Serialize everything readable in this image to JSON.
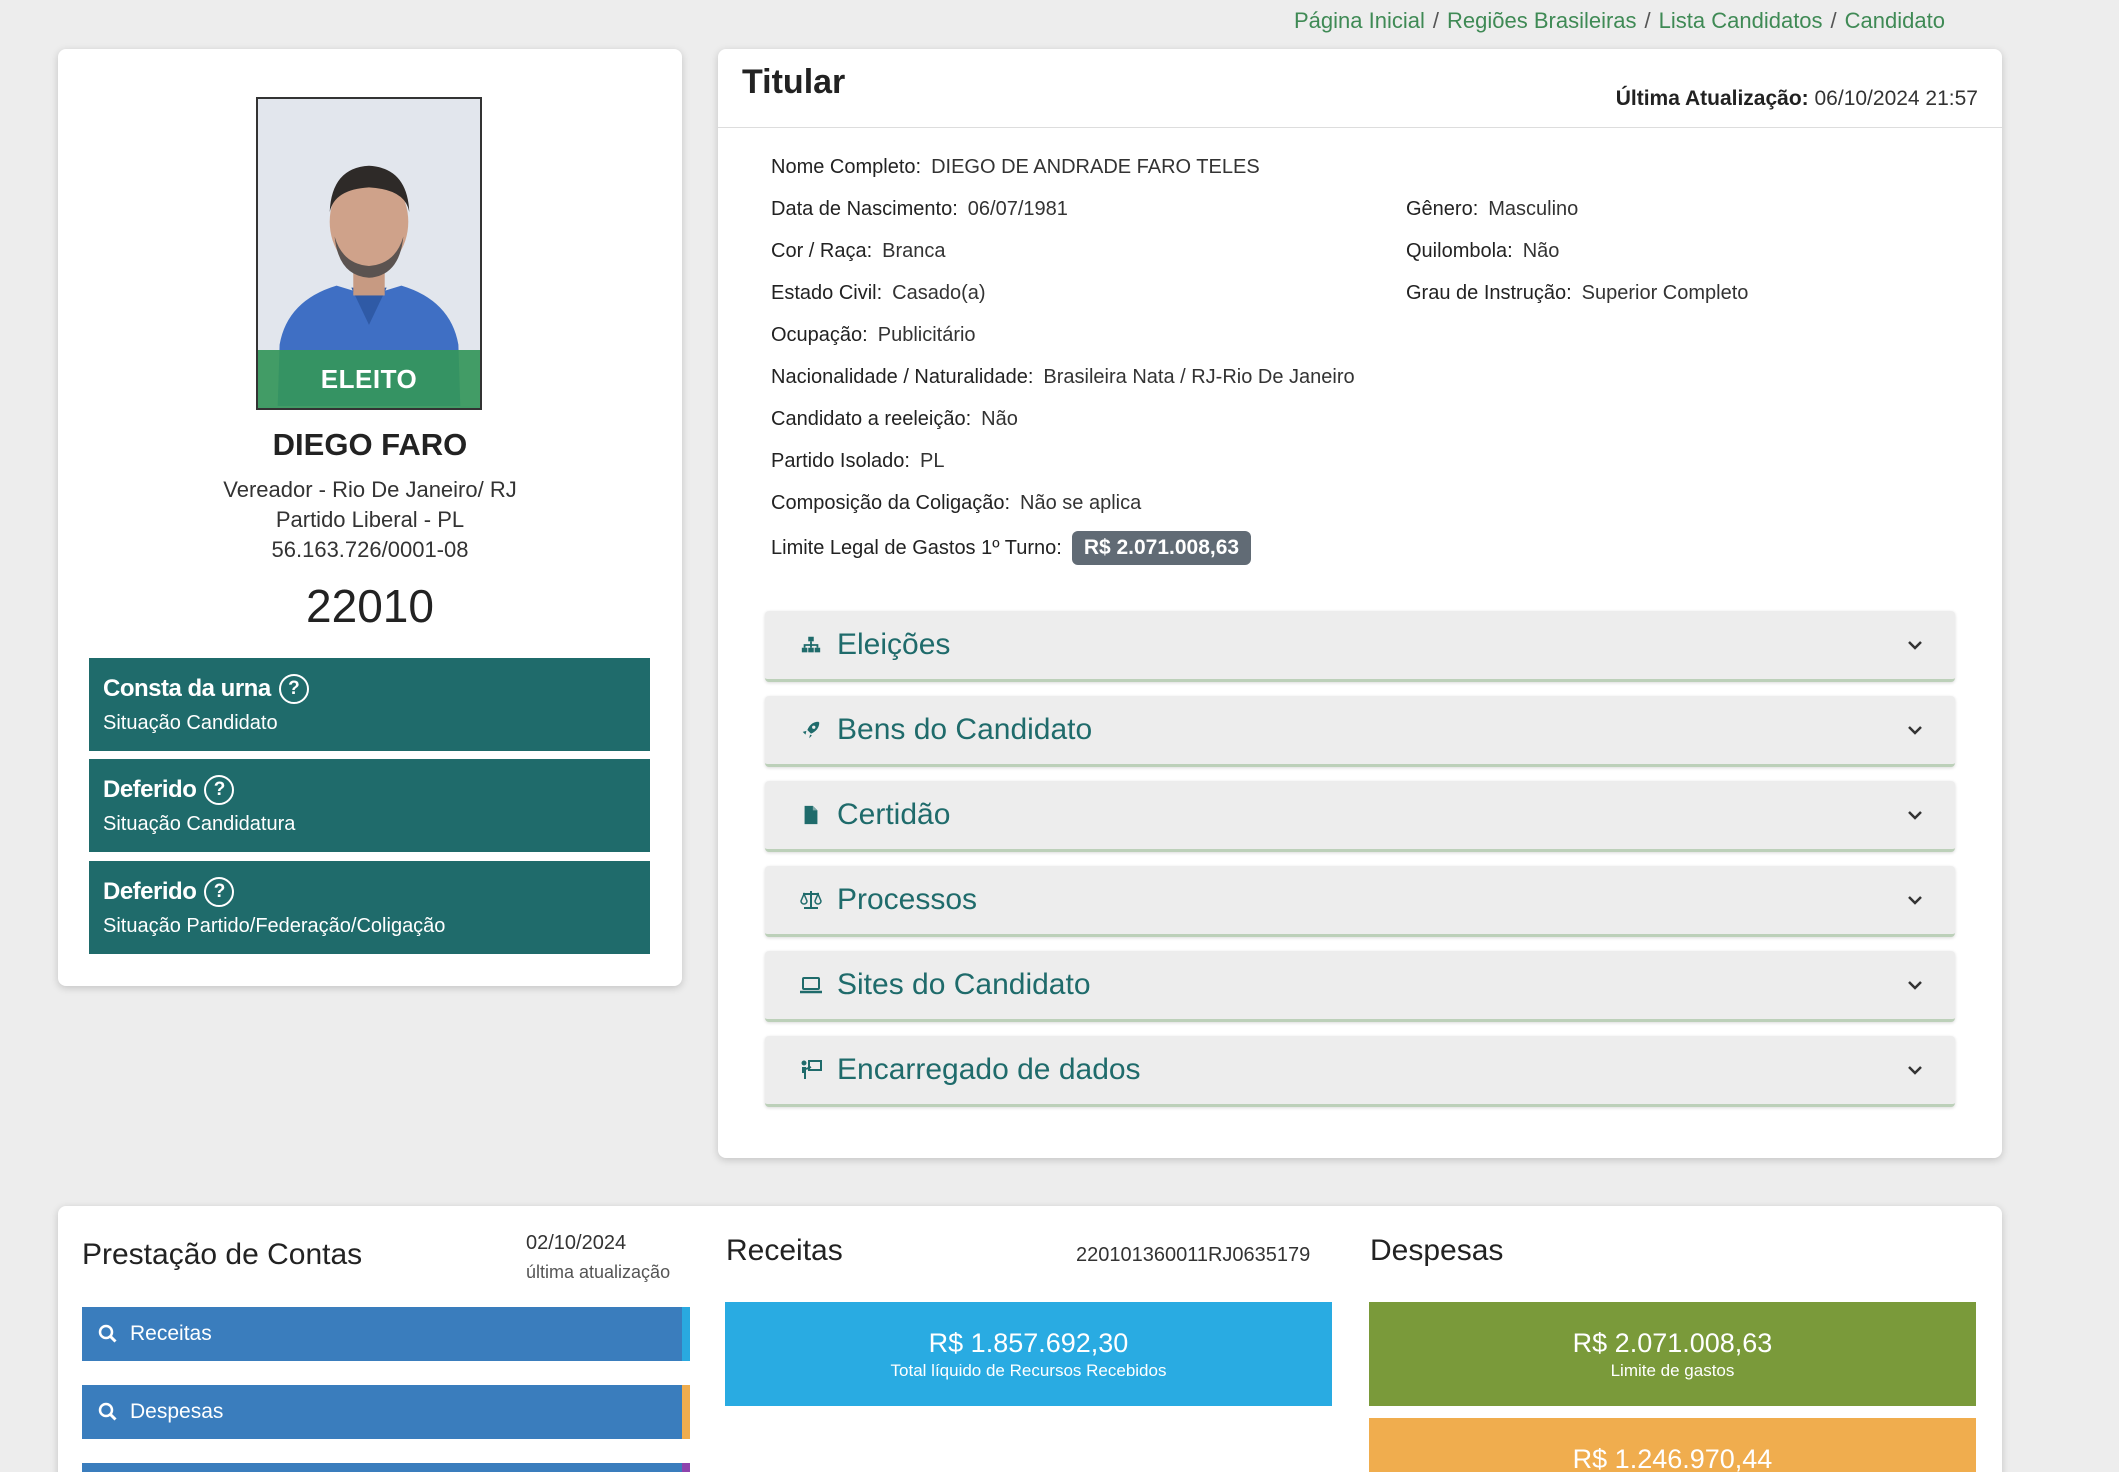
{
  "breadcrumb": {
    "items": [
      "Página Inicial",
      "Regiões Brasileiras",
      "Lista Candidatos",
      "Candidato"
    ],
    "separator": "/"
  },
  "candidate": {
    "photo_status": "ELEITO",
    "name": "DIEGO FARO",
    "office_line": "Vereador - Rio De Janeiro/ RJ",
    "party_line": "Partido Liberal - PL",
    "cnpj": "56.163.726/0001-08",
    "number": "22010",
    "statuses": [
      {
        "title": "Consta da urna",
        "subtitle": "Situação Candidato"
      },
      {
        "title": "Deferido",
        "subtitle": "Situação Candidatura"
      },
      {
        "title": "Deferido",
        "subtitle": "Situação Partido/Federação/Coligação"
      }
    ]
  },
  "titular": {
    "title": "Titular",
    "update_label": "Última Atualização:",
    "update_value": "06/10/2024 21:57",
    "fields": {
      "nome_completo": {
        "label": "Nome Completo:",
        "value": "DIEGO DE ANDRADE FARO TELES"
      },
      "data_nascimento": {
        "label": "Data de Nascimento:",
        "value": "06/07/1981"
      },
      "genero": {
        "label": "Gênero:",
        "value": "Masculino"
      },
      "cor_raca": {
        "label": "Cor / Raça:",
        "value": "Branca"
      },
      "quilombola": {
        "label": "Quilombola:",
        "value": "Não"
      },
      "estado_civil": {
        "label": "Estado Civil:",
        "value": "Casado(a)"
      },
      "grau_instrucao": {
        "label": "Grau de Instrução:",
        "value": "Superior Completo"
      },
      "ocupacao": {
        "label": "Ocupação:",
        "value": "Publicitário"
      },
      "nacionalidade": {
        "label": "Nacionalidade / Naturalidade:",
        "value": "Brasileira Nata / RJ-Rio De Janeiro"
      },
      "reeleicao": {
        "label": "Candidato a reeleição:",
        "value": "Não"
      },
      "partido": {
        "label": "Partido Isolado:",
        "value": "PL"
      },
      "coligacao": {
        "label": "Composição da Coligação:",
        "value": "Não se aplica"
      },
      "limite": {
        "label": "Limite Legal de Gastos 1º Turno:",
        "value": "R$ 2.071.008,63"
      }
    },
    "accordions": [
      {
        "label": "Eleições",
        "icon": "sitemap-icon"
      },
      {
        "label": "Bens do Candidato",
        "icon": "rocket-icon"
      },
      {
        "label": "Certidão",
        "icon": "file-icon"
      },
      {
        "label": "Processos",
        "icon": "scale-icon"
      },
      {
        "label": "Sites do Candidato",
        "icon": "laptop-icon"
      },
      {
        "label": "Encarregado de dados",
        "icon": "person-board-icon"
      }
    ]
  },
  "contas": {
    "title": "Prestação de Contas",
    "date": "02/10/2024",
    "date_sub": "última atualização",
    "buttons": [
      {
        "label": "Receitas",
        "edge_color": "#29a9e0"
      },
      {
        "label": "Despesas",
        "edge_color": "#f0ad4e"
      },
      {
        "label": "",
        "edge_color": "#8e44ad"
      }
    ],
    "receitas": {
      "title": "Receitas",
      "code": "220101360011RJ0635179",
      "amount": "R$ 1.857.692,30",
      "caption": "Total líquido de Recursos Recebidos",
      "color": "#29abe2"
    },
    "despesas": {
      "title": "Despesas",
      "limit_amount": "R$ 2.071.008,63",
      "limit_caption": "Limite de gastos",
      "limit_color": "#7a9a3a",
      "second_amount": "R$ 1.246.970,44",
      "second_color": "#f0ad4e"
    }
  }
}
